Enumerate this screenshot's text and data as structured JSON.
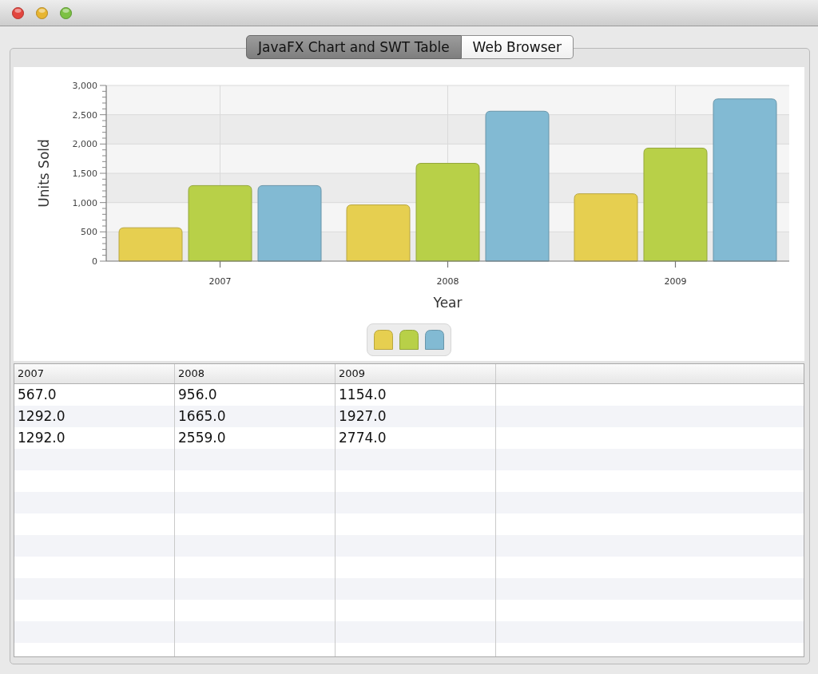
{
  "tabs": [
    {
      "label": "JavaFX Chart and SWT Table",
      "selected": true
    },
    {
      "label": "Web Browser",
      "selected": false
    }
  ],
  "chart": {
    "chart_data": {
      "type": "bar",
      "xlabel": "Year",
      "ylabel": "Units Sold",
      "categories": [
        "2007",
        "2008",
        "2009"
      ],
      "series": [
        {
          "color": "#e6cf50",
          "values": [
            570,
            960,
            1150
          ]
        },
        {
          "color": "#b8d048",
          "values": [
            1290,
            1670,
            1930
          ]
        },
        {
          "color": "#82bad3",
          "values": [
            1290,
            2560,
            2770
          ]
        }
      ],
      "ylim": [
        0,
        3000
      ],
      "yticks": [
        0,
        500,
        {
          "value": 1000,
          "label": "1,000"
        },
        {
          "value": 1500,
          "label": "1,500"
        },
        {
          "value": 2000,
          "label": "2,000"
        },
        {
          "value": 2500,
          "label": "2,500"
        },
        {
          "value": 3000,
          "label": "3,000"
        }
      ],
      "grid": true
    }
  },
  "table": {
    "columns": [
      "2007",
      "2008",
      "2009"
    ],
    "rows": [
      [
        "567.0",
        "956.0",
        "1154.0"
      ],
      [
        "1292.0",
        "1665.0",
        "1927.0"
      ],
      [
        "1292.0",
        "2559.0",
        "2774.0"
      ]
    ]
  }
}
